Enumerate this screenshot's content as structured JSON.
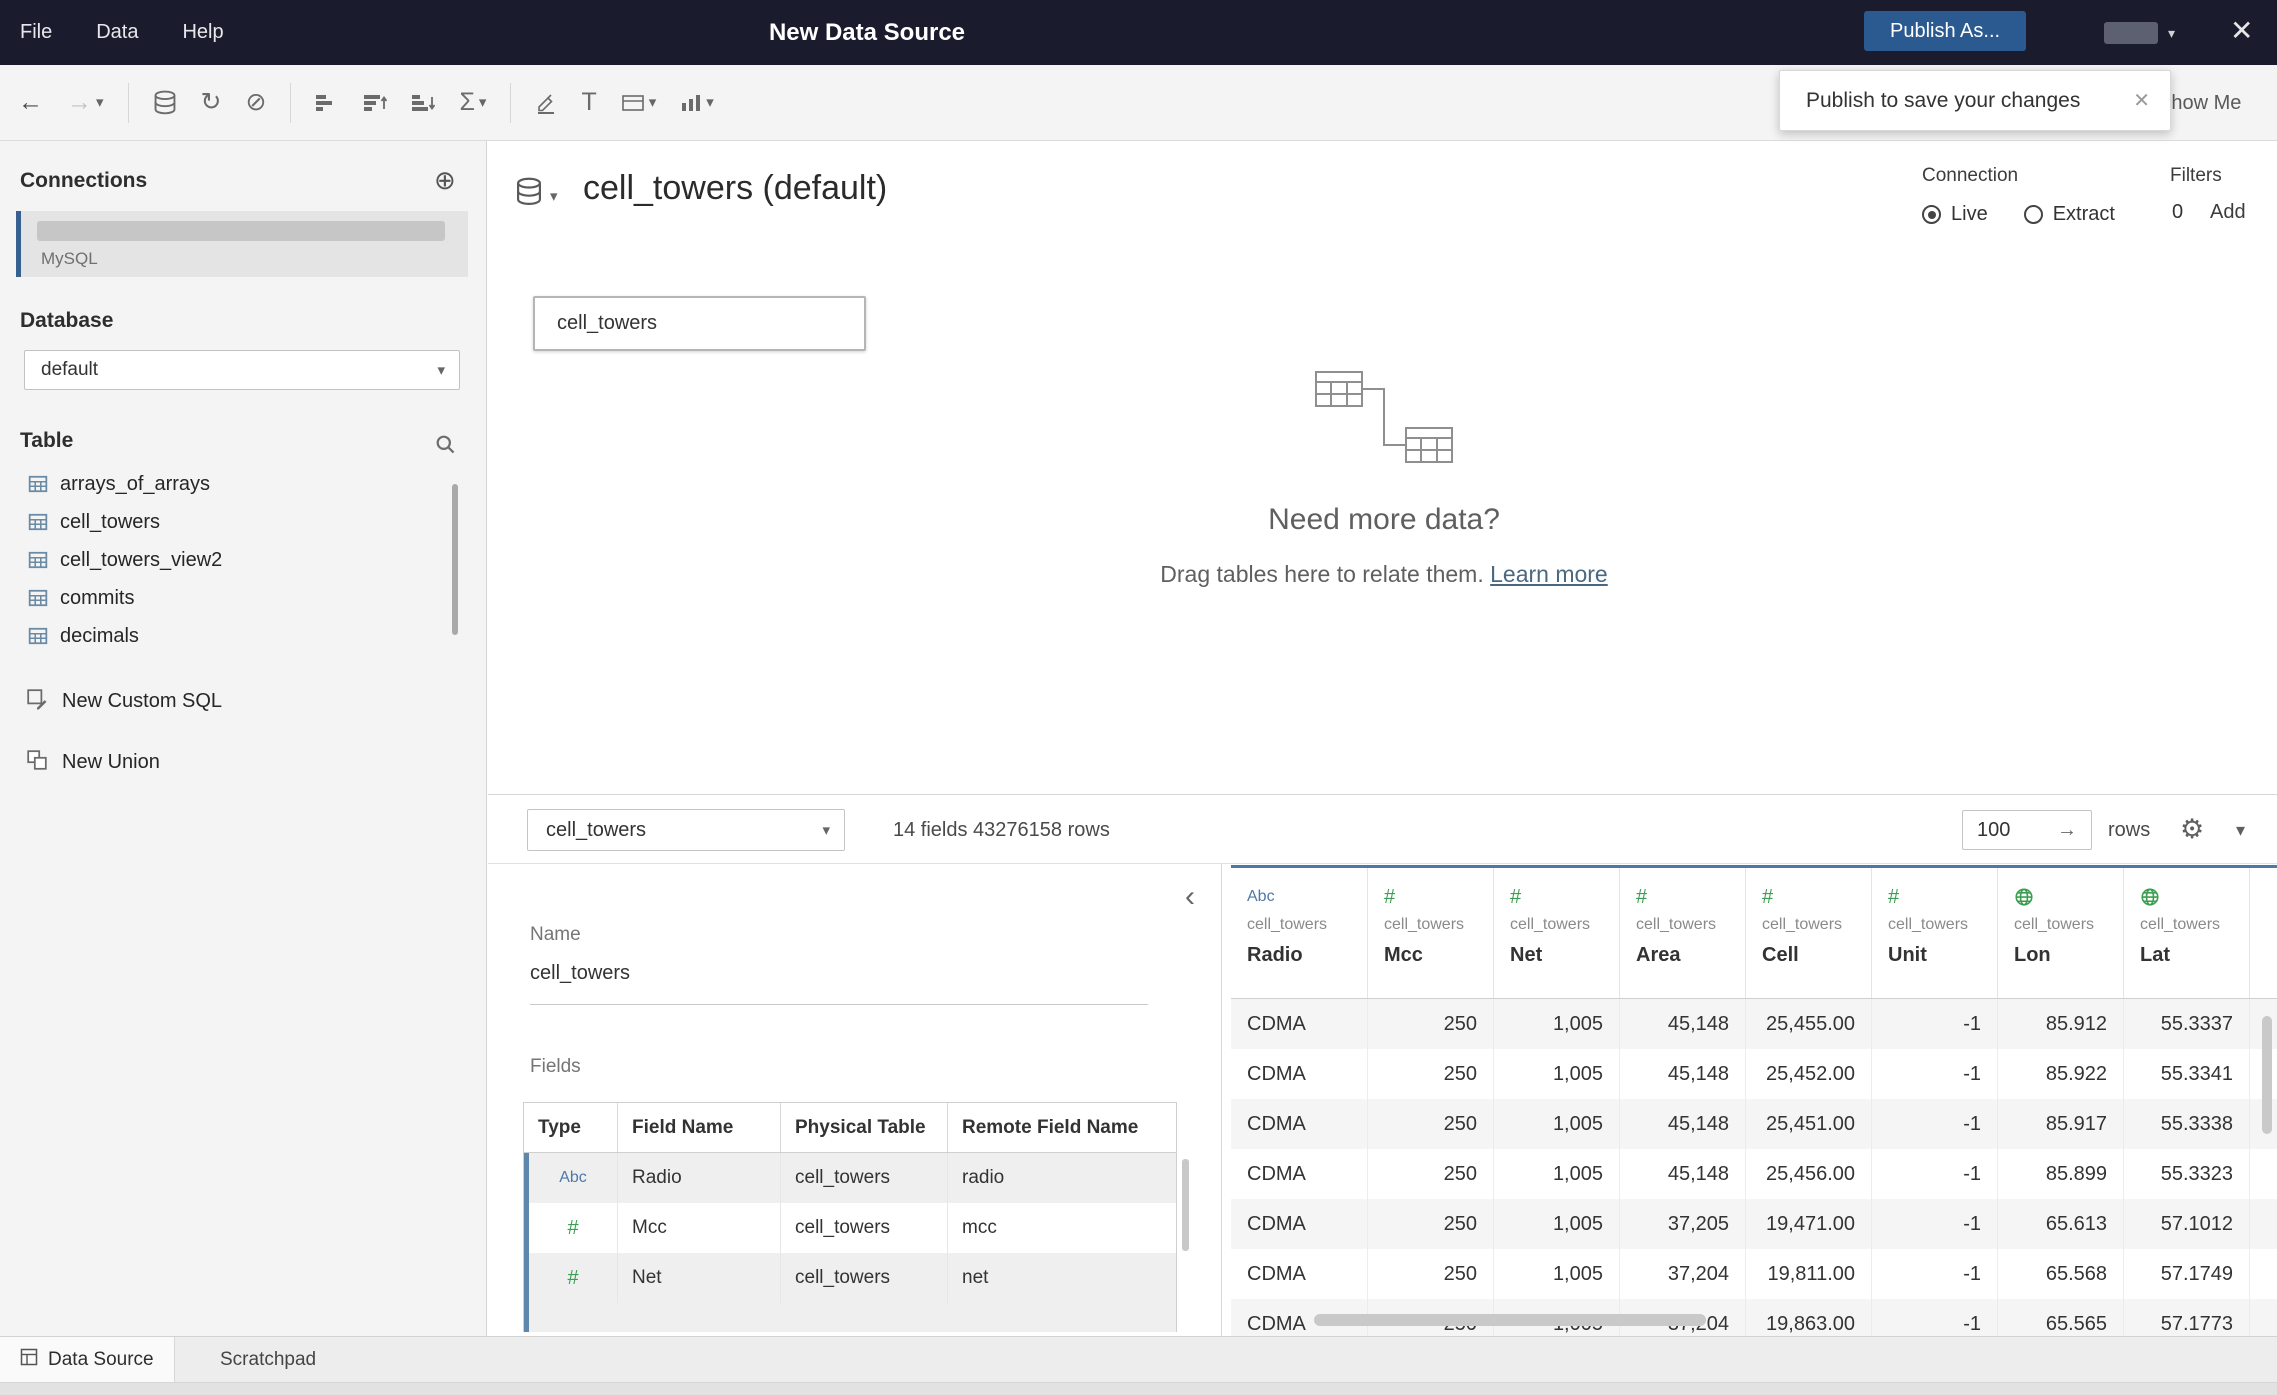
{
  "window": {
    "title": "New Data Source",
    "menus": [
      "File",
      "Data",
      "Help"
    ],
    "publish_label": "Publish As..."
  },
  "icons": {
    "caret": "▾",
    "close": "✕",
    "undo": "←",
    "redo": "→",
    "refresh": "↻",
    "cancel": "⊘",
    "sigma": "Σ",
    "text_label": "T",
    "gear": "⚙",
    "plus_circle": "⊕",
    "collapse_left": "‹",
    "go_arrow": "→"
  },
  "tooltip": {
    "text": "Publish to save your changes"
  },
  "toolbar": {
    "show_me": "Show Me"
  },
  "sidebar": {
    "connections_title": "Connections",
    "connection_type": "MySQL",
    "database_title": "Database",
    "database_selected": "default",
    "table_title": "Table",
    "table_items": [
      "arrays_of_arrays",
      "cell_towers",
      "cell_towers_view2",
      "commits",
      "decimals"
    ],
    "new_custom_sql": "New Custom SQL",
    "new_union": "New Union"
  },
  "main": {
    "datasource_title": "cell_towers (default)",
    "connection_label": "Connection",
    "live_label": "Live",
    "extract_label": "Extract",
    "filters_label": "Filters",
    "filters_count": "0",
    "add_link": "Add",
    "table_node": "cell_towers",
    "need_more": "Need more data?",
    "drag_hint": "Drag tables here to relate them.",
    "learn_more": "Learn more"
  },
  "bottombar": {
    "table_selected": "cell_towers",
    "fields_summary": "14 fields 43276158 rows",
    "rows_value": "100",
    "rows_label": "rows"
  },
  "metadata": {
    "name_label": "Name",
    "name_value": "cell_towers",
    "fields_label": "Fields",
    "columns": [
      "Type",
      "Field Name",
      "Physical Table",
      "Remote Field Name"
    ],
    "rows": [
      {
        "icon": "Abc",
        "field": "Radio",
        "table": "cell_towers",
        "remote": "radio"
      },
      {
        "icon": "#",
        "field": "Mcc",
        "table": "cell_towers",
        "remote": "mcc"
      },
      {
        "icon": "#",
        "field": "Net",
        "table": "cell_towers",
        "remote": "net"
      }
    ]
  },
  "grid": {
    "columns": [
      {
        "icon": "Abc",
        "table": "cell_towers",
        "field": "Radio"
      },
      {
        "icon": "#",
        "table": "cell_towers",
        "field": "Mcc"
      },
      {
        "icon": "#",
        "table": "cell_towers",
        "field": "Net"
      },
      {
        "icon": "#",
        "table": "cell_towers",
        "field": "Area"
      },
      {
        "icon": "#",
        "table": "cell_towers",
        "field": "Cell"
      },
      {
        "icon": "#",
        "table": "cell_towers",
        "field": "Unit"
      },
      {
        "icon": "globe",
        "table": "cell_towers",
        "field": "Lon"
      },
      {
        "icon": "globe",
        "table": "cell_towers",
        "field": "Lat"
      }
    ],
    "rows": [
      [
        "CDMA",
        "250",
        "1,005",
        "45,148",
        "25,455.00",
        "-1",
        "85.912",
        "55.3337"
      ],
      [
        "CDMA",
        "250",
        "1,005",
        "45,148",
        "25,452.00",
        "-1",
        "85.922",
        "55.3341"
      ],
      [
        "CDMA",
        "250",
        "1,005",
        "45,148",
        "25,451.00",
        "-1",
        "85.917",
        "55.3338"
      ],
      [
        "CDMA",
        "250",
        "1,005",
        "45,148",
        "25,456.00",
        "-1",
        "85.899",
        "55.3323"
      ],
      [
        "CDMA",
        "250",
        "1,005",
        "37,205",
        "19,471.00",
        "-1",
        "65.613",
        "57.1012"
      ],
      [
        "CDMA",
        "250",
        "1,005",
        "37,204",
        "19,811.00",
        "-1",
        "65.568",
        "57.1749"
      ],
      [
        "CDMA",
        "250",
        "1,005",
        "37,204",
        "19,863.00",
        "-1",
        "65.565",
        "57.1773"
      ]
    ]
  },
  "statusbar": {
    "tabs": [
      "Data Source",
      "Scratchpad"
    ]
  },
  "theme": {
    "titlebar": "#1a1c2e",
    "publish_button": "#2a5a8f",
    "accent_blue": "#4e79a7",
    "type_green": "#3c9e52",
    "row_accent": "#5f87ab"
  }
}
